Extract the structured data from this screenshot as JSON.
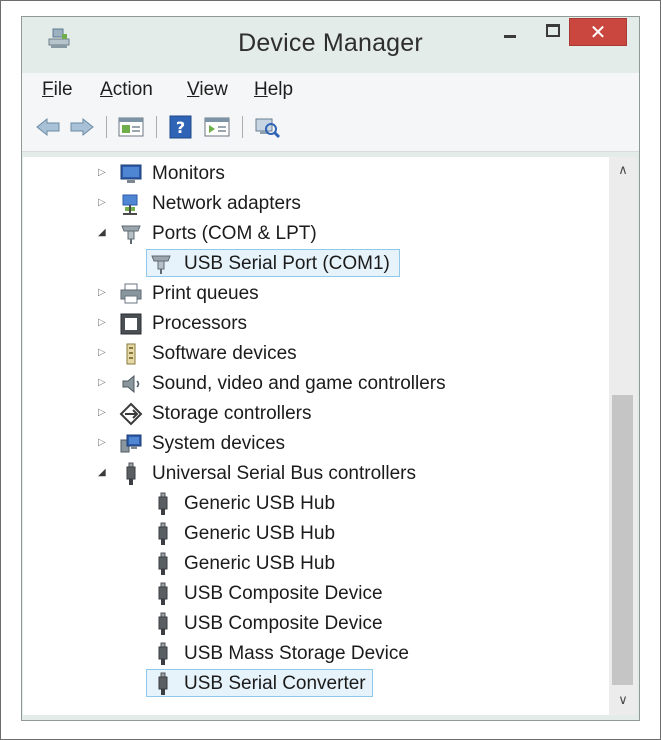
{
  "window": {
    "title": "Device Manager",
    "close_glyph": "✕"
  },
  "menu": [
    {
      "hotkey": "F",
      "rest": "ile"
    },
    {
      "hotkey": "A",
      "rest": "ction"
    },
    {
      "hotkey": "V",
      "rest": "iew"
    },
    {
      "hotkey": "H",
      "rest": "elp"
    }
  ],
  "toolbar": [
    "back-icon",
    "forward-icon",
    "properties-icon",
    "help-icon",
    "update-driver-icon",
    "scan-hardware-icon"
  ],
  "tree": [
    {
      "label": "Monitors",
      "icon": "monitor-icon",
      "expanded": false
    },
    {
      "label": "Network adapters",
      "icon": "network-adapter-icon",
      "expanded": false
    },
    {
      "label": "Ports (COM & LPT)",
      "icon": "port-icon",
      "expanded": true
    },
    {
      "label": "USB Serial Port (COM1)",
      "icon": "port-icon",
      "child": true,
      "selected": true
    },
    {
      "label": "Print queues",
      "icon": "printer-icon",
      "expanded": false
    },
    {
      "label": "Processors",
      "icon": "processor-icon",
      "expanded": false
    },
    {
      "label": "Software devices",
      "icon": "software-device-icon",
      "expanded": false
    },
    {
      "label": "Sound, video and game controllers",
      "icon": "speaker-icon",
      "expanded": false
    },
    {
      "label": "Storage controllers",
      "icon": "storage-controller-icon",
      "expanded": false
    },
    {
      "label": "System devices",
      "icon": "system-device-icon",
      "expanded": false
    },
    {
      "label": "Universal Serial Bus controllers",
      "icon": "usb-icon",
      "expanded": true
    },
    {
      "label": "Generic USB Hub",
      "icon": "usb-icon",
      "child": true
    },
    {
      "label": "Generic USB Hub",
      "icon": "usb-icon",
      "child": true
    },
    {
      "label": "Generic USB Hub",
      "icon": "usb-icon",
      "child": true
    },
    {
      "label": "USB Composite Device",
      "icon": "usb-icon",
      "child": true
    },
    {
      "label": "USB Composite Device",
      "icon": "usb-icon",
      "child": true
    },
    {
      "label": "USB Mass Storage Device",
      "icon": "usb-icon",
      "child": true
    },
    {
      "label": "USB Serial Converter",
      "icon": "usb-icon",
      "child": true,
      "selected": true
    }
  ],
  "colors": {
    "selection_bg": "#e7f3fb",
    "selection_border": "#8fc8ea",
    "close_button": "#c9473f",
    "window_frame": "#e3ece8"
  }
}
